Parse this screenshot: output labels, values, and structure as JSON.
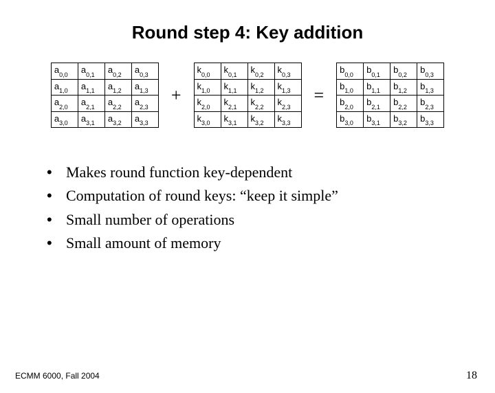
{
  "title": "Round step 4: Key addition",
  "matrices": {
    "a": {
      "prefix": "a",
      "rows": 4,
      "cols": 4
    },
    "op1": "+",
    "k": {
      "prefix": "k",
      "rows": 4,
      "cols": 4
    },
    "op2": "=",
    "b": {
      "prefix": "b",
      "rows": 4,
      "cols": 4
    }
  },
  "bullets": [
    "Makes round function key-dependent",
    "Computation of round keys: “keep it simple”",
    "Small number of operations",
    "Small amount of memory"
  ],
  "footer_left": "ECMM 6000, Fall 2004",
  "footer_right": "18"
}
